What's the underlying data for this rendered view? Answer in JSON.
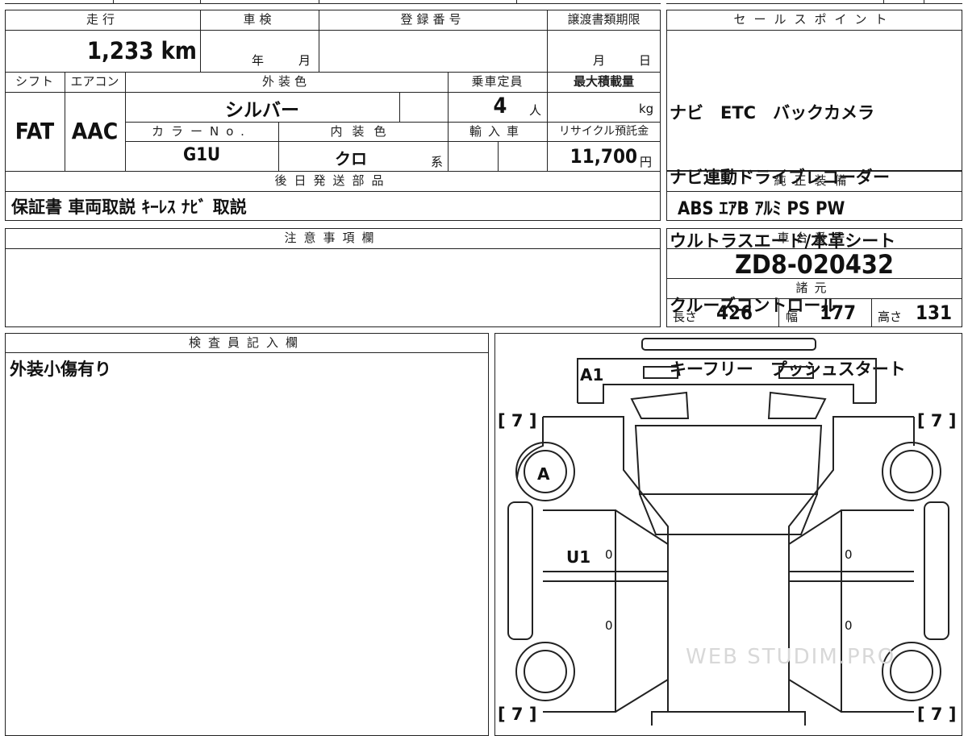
{
  "mileage": {
    "label": "走行",
    "value": "1,233 km"
  },
  "inspection": {
    "label": "車検",
    "year_unit": "年",
    "month_unit": "月"
  },
  "registration": {
    "label": "登録番号",
    "value": ""
  },
  "transfer": {
    "label": "譲渡書類期限",
    "month_unit": "月",
    "day_unit": "日"
  },
  "sales_points": {
    "label": "セールスポイント",
    "lines": [
      "ナビ　ETC　バックカメラ",
      "ナビ連動ドライブレコーダー",
      "ウルトラスエード/本革シート",
      "クルーズコントロール",
      "キーフリー　プッシュスタート"
    ]
  },
  "shift": {
    "label": "シフト",
    "value": "FAT"
  },
  "aircon": {
    "label": "エアコン",
    "value": "AAC"
  },
  "exterior_color": {
    "label": "外装色",
    "value": "シルバー"
  },
  "capacity": {
    "label": "乗車定員",
    "value": "4",
    "unit": "人"
  },
  "max_load": {
    "label": "最大積載量",
    "unit": "kg"
  },
  "color_no": {
    "label": "カラーNo.",
    "value": "G1U"
  },
  "interior_color": {
    "label": "内装色",
    "value": "クロ",
    "unit": "系"
  },
  "import": {
    "label": "輸入車"
  },
  "recycle": {
    "label": "リサイクル預託金",
    "value": "11,700",
    "unit": "円"
  },
  "later_shipping": {
    "label": "後日発送部品",
    "value": "保証書 車両取説 ｷｰﾚｽ ﾅﾋﾞ 取説"
  },
  "genuine_equipment": {
    "label": "純正装備",
    "value": "ABS ｴｱB ｱﾙﾐ PS PW"
  },
  "notes": {
    "label": "注意事項欄",
    "value": ""
  },
  "chassis_no": {
    "label": "車台番号",
    "value": "ZD8-020432"
  },
  "specs": {
    "label": "諸元",
    "length_label": "長さ",
    "length": "426",
    "width_label": "幅",
    "width": "177",
    "height_label": "高さ",
    "height": "131"
  },
  "inspector": {
    "label": "検査員記入欄",
    "value": "外装小傷有り"
  },
  "diagram": {
    "labels": {
      "a1": "A1",
      "a": "A",
      "u1": "U1"
    },
    "tire_marks": {
      "fl": "[ 7 ]",
      "fr": "[ 7 ]",
      "rl": "[ 7 ]",
      "rr": "[ 7 ]"
    },
    "zeros": [
      "0",
      "0",
      "0",
      "0"
    ],
    "watermark": "WEB STUDIM.PRO"
  }
}
